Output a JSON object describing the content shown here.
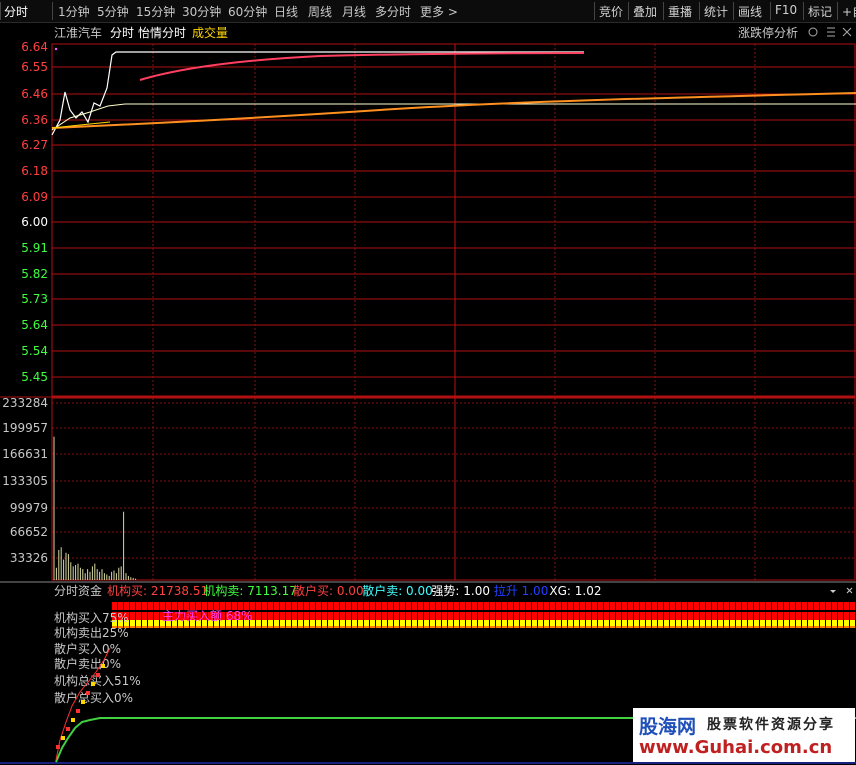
{
  "toolbar": {
    "left_tabs": [
      "分时",
      "1分钟",
      "5分钟",
      "15分钟",
      "30分钟",
      "60分钟",
      "日线",
      "周线",
      "月线",
      "多分时",
      "更多 >"
    ],
    "right_tabs": [
      "竞价",
      "叠加",
      "重播",
      "统计",
      "画线",
      "F10",
      "标记",
      "+自"
    ]
  },
  "header": {
    "stock_name": "江淮汽车",
    "items": [
      "分时",
      "怡情分时"
    ],
    "volume_label": "成交量",
    "right_label": "涨跌停分析",
    "right_icons": [
      "gear-icon",
      "menu-icon",
      "close-icon"
    ]
  },
  "price_axis": {
    "labels": [
      "6.64",
      "6.55",
      "6.46",
      "6.36",
      "6.27",
      "6.18",
      "6.09",
      "6.00",
      "5.91",
      "5.82",
      "5.73",
      "5.64",
      "5.54",
      "5.45"
    ],
    "up_color": "#ff4040",
    "flat_color": "#ffffff",
    "down_color": "#40ff40"
  },
  "volume_axis": {
    "labels": [
      "233284",
      "199957",
      "166631",
      "133305",
      "99979",
      "66652",
      "33326"
    ]
  },
  "fund_panel": {
    "title": "分时资金",
    "metrics": [
      {
        "label": "机构买:",
        "value": "21738.51",
        "color": "#ff4040"
      },
      {
        "label": "机构卖:",
        "value": "7113.17",
        "color": "#40ff40"
      },
      {
        "label": "散户买:",
        "value": "0.00",
        "color": "#ff4040"
      },
      {
        "label": "散户卖:",
        "value": "0.00",
        "color": "#40ffff"
      },
      {
        "label": "强势:",
        "value": "1.00",
        "color": "#ffffff"
      },
      {
        "label": "拉升",
        "value": "1.00",
        "color": "#2040ff"
      },
      {
        "label": "XG:",
        "value": "1.02",
        "color": "#ffffff"
      }
    ],
    "stats": [
      "机构买入75%",
      "机构卖出25%",
      "散户买入0%",
      "散户卖出0%",
      "机构总买入51%",
      "散户总买入0%"
    ],
    "bar_label": "主力买入额 68%",
    "panel_icons": [
      "dropdown-icon",
      "close-icon"
    ]
  },
  "chart_data": [
    {
      "type": "line",
      "y_labels": [
        "6.64",
        "6.55",
        "6.46",
        "6.36",
        "6.27",
        "6.18",
        "6.09",
        "6.00",
        "5.91",
        "5.82",
        "5.73",
        "5.64",
        "5.54",
        "5.45"
      ],
      "series_colors": {
        "price": "#ffffff",
        "avg": "#ffd700",
        "line_a": "#ff4060",
        "line_b": "#ff9020"
      }
    },
    {
      "type": "bar",
      "y_labels": [
        "233284",
        "199957",
        "166631",
        "133305",
        "99979",
        "66652",
        "33326"
      ],
      "ylim": [
        0,
        266610
      ],
      "values": [
        210000,
        18000,
        44000,
        48000,
        30000,
        40000,
        38000,
        26000,
        20000,
        22000,
        24000,
        18000,
        16000,
        10000,
        16000,
        12000,
        20000,
        24000,
        16000,
        12000,
        16000,
        10000,
        8000,
        6000,
        12000,
        14000,
        10000,
        18000,
        20000,
        100000,
        10000,
        6000,
        4000,
        3000,
        2000
      ]
    }
  ],
  "watermark": {
    "name": "股海网",
    "subtitle": "股票软件资源分享",
    "url": "www.Guhai.com.cn"
  }
}
